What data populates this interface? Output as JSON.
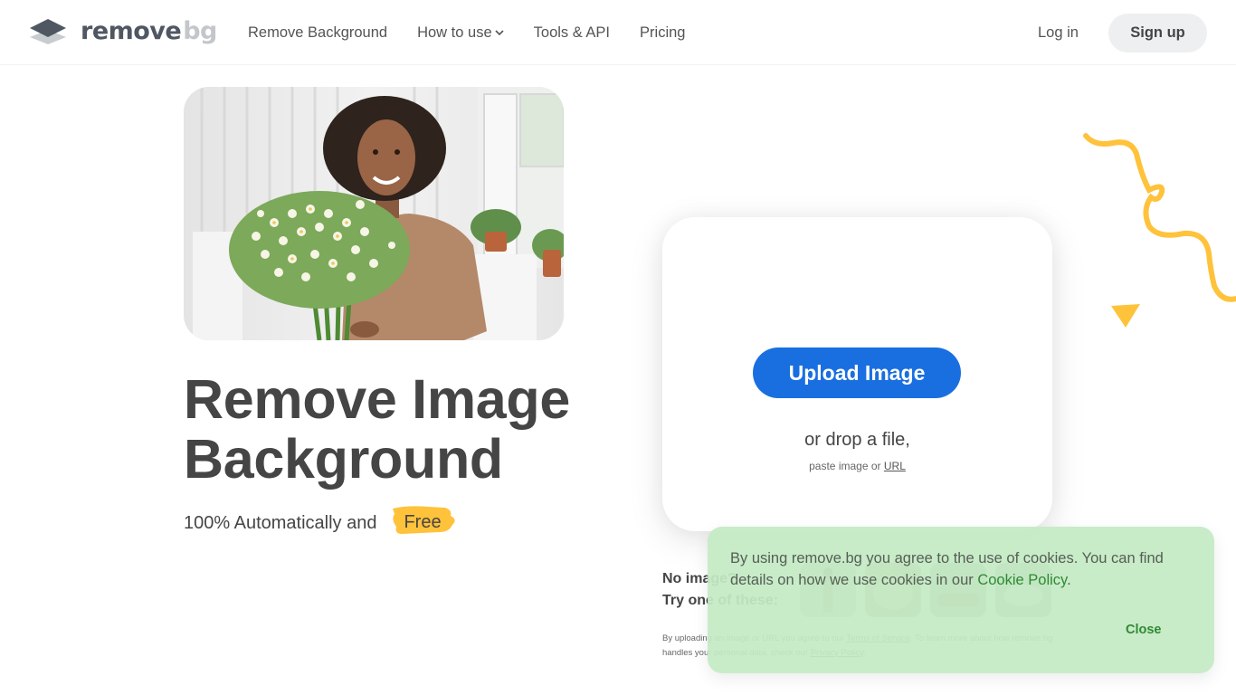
{
  "header": {
    "logo": {
      "word1": "remove",
      "word2": "bg",
      "icon": "layers-icon"
    },
    "nav": [
      {
        "label": "Remove Background"
      },
      {
        "label": "How to use",
        "icon": "chevron-down-icon"
      },
      {
        "label": "Tools & API"
      },
      {
        "label": "Pricing"
      }
    ],
    "login_label": "Log in",
    "signup_label": "Sign up"
  },
  "hero": {
    "image_alt": "Smiling woman holding a bouquet of white daisies",
    "title_line1": "Remove Image",
    "title_line2": "Background",
    "subtitle": "100% Automatically and",
    "badge": "Free"
  },
  "upload": {
    "button_label": "Upload Image",
    "drop_text": "or drop a file,",
    "paste_prefix": "paste image or",
    "url_link": "URL"
  },
  "samples": {
    "line1": "No image?",
    "line2": "Try one of these:",
    "items": [
      {
        "name": "sample-person"
      },
      {
        "name": "sample-animal"
      },
      {
        "name": "sample-car"
      },
      {
        "name": "sample-product"
      }
    ]
  },
  "terms": {
    "prefix": "By uploading an image or URL you agree to our",
    "tos_link": "Terms of Service",
    "middle": ". To learn more about how remove.bg handles your personal data, check our",
    "privacy_link": "Privacy Policy",
    "suffix": "."
  },
  "cookie": {
    "text": "By using remove.bg you agree to the use of cookies. You can find details on how we use cookies in our",
    "policy_link": "Cookie Policy",
    "suffix": ".",
    "close_label": "Close"
  },
  "colors": {
    "primary_blue": "#1a6fe0",
    "accent_yellow": "#ffc23b",
    "text_dark": "#454545",
    "cookie_bg": "#c4e9c4",
    "cookie_link": "#2f8a34"
  }
}
